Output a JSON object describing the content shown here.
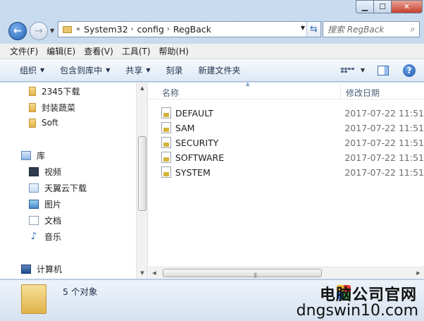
{
  "address": {
    "crumbs": [
      "System32",
      "config",
      "RegBack"
    ]
  },
  "search": {
    "placeholder": "搜索 RegBack"
  },
  "menu": [
    "文件(F)",
    "编辑(E)",
    "查看(V)",
    "工具(T)",
    "帮助(H)"
  ],
  "commands": {
    "organize": "组织",
    "include_library": "包含到库中",
    "share": "共享",
    "burn": "刻录",
    "new_folder": "新建文件夹"
  },
  "tree": {
    "folders": [
      "2345下载",
      "封装蔬菜",
      "Soft"
    ],
    "library": "库",
    "library_items": [
      "视频",
      "天翼云下载",
      "图片",
      "文档",
      "音乐"
    ],
    "computer": "计算机"
  },
  "columns": {
    "name": "名称",
    "modified": "修改日期"
  },
  "files": [
    {
      "name": "DEFAULT",
      "date": "2017-07-22 11:51"
    },
    {
      "name": "SAM",
      "date": "2017-07-22 11:51"
    },
    {
      "name": "SECURITY",
      "date": "2017-07-22 11:51"
    },
    {
      "name": "SOFTWARE",
      "date": "2017-07-22 11:51"
    },
    {
      "name": "SYSTEM",
      "date": "2017-07-22 11:51"
    }
  ],
  "details": {
    "count": "5 个对象"
  },
  "watermark": {
    "line1": "电脑公司官网",
    "line2": "dngswin10.com"
  }
}
